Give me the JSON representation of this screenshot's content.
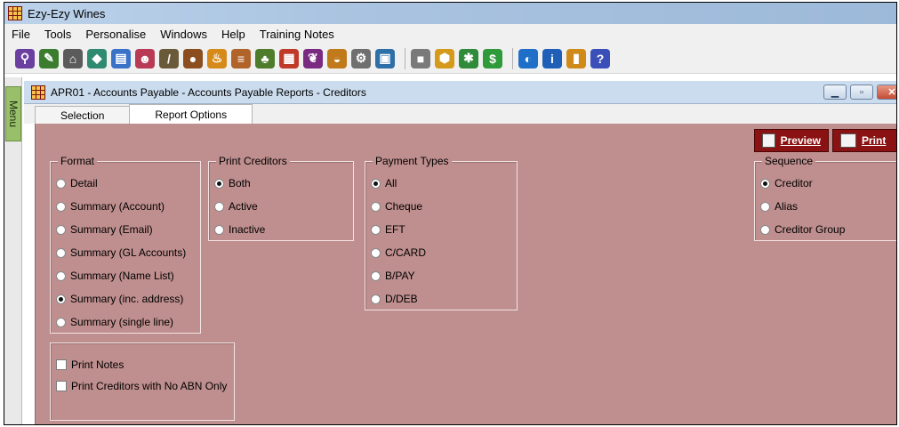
{
  "app": {
    "title": "Ezy-Ezy Wines"
  },
  "menubar": [
    "File",
    "Tools",
    "Personalise",
    "Windows",
    "Help",
    "Training Notes"
  ],
  "toolbar": {
    "icons": [
      {
        "name": "wine-glass-icon",
        "color": "#6a3fa0",
        "glyph": "⚲"
      },
      {
        "name": "pen-icon",
        "color": "#3b7c2f",
        "glyph": "✎"
      },
      {
        "name": "bank-icon",
        "color": "#5b5b5b",
        "glyph": "⌂"
      },
      {
        "name": "label-icon",
        "color": "#2f8a6f",
        "glyph": "◆"
      },
      {
        "name": "document-icon",
        "color": "#3a72c8",
        "glyph": "▤"
      },
      {
        "name": "people-icon",
        "color": "#b83a55",
        "glyph": "☻"
      },
      {
        "name": "stick-icon",
        "color": "#6a5a3a",
        "glyph": "/"
      },
      {
        "name": "barrel-icon",
        "color": "#8c4e1f",
        "glyph": "●"
      },
      {
        "name": "bottle-icon",
        "color": "#d68a1a",
        "glyph": "♨"
      },
      {
        "name": "cellar-icon",
        "color": "#b0642a",
        "glyph": "≡"
      },
      {
        "name": "vineyard-icon",
        "color": "#4d7c2a",
        "glyph": "♣"
      },
      {
        "name": "crates-icon",
        "color": "#c03a2a",
        "glyph": "▦"
      },
      {
        "name": "grapes-icon",
        "color": "#7a2a80",
        "glyph": "❦"
      },
      {
        "name": "basket-icon",
        "color": "#c07a1a",
        "glyph": "◒"
      },
      {
        "name": "settings-icon",
        "color": "#6f6f6f",
        "glyph": "⚙"
      },
      {
        "name": "report-icon",
        "color": "#2e6fa8",
        "glyph": "▣"
      },
      {
        "name": "sep",
        "color": "",
        "glyph": ""
      },
      {
        "name": "printer-icon",
        "color": "#7a7a7a",
        "glyph": "■"
      },
      {
        "name": "box-icon",
        "color": "#d59a1b",
        "glyph": "⬢"
      },
      {
        "name": "gear-green-icon",
        "color": "#2f8a3a",
        "glyph": "✱"
      },
      {
        "name": "dollar-icon",
        "color": "#2f9a3a",
        "glyph": "$"
      },
      {
        "name": "sep",
        "color": "",
        "glyph": ""
      },
      {
        "name": "globe-icon",
        "color": "#1f6fc8",
        "glyph": "◐"
      },
      {
        "name": "info-icon",
        "color": "#1f5fb8",
        "glyph": "i"
      },
      {
        "name": "bookmark-icon",
        "color": "#d08a1a",
        "glyph": "▮"
      },
      {
        "name": "help-icon",
        "color": "#3a4fb8",
        "glyph": "?"
      }
    ]
  },
  "sidebar": {
    "menu_label": "Menu"
  },
  "window": {
    "title": "APR01 - Accounts Payable - Accounts Payable Reports -  Creditors",
    "minimize": "▁",
    "maximize": "▫",
    "close": "✕"
  },
  "tabs": [
    {
      "label": "Selection",
      "active": false
    },
    {
      "label": "Report Options",
      "active": true
    }
  ],
  "actions": {
    "preview": "Preview",
    "print": "Print"
  },
  "format": {
    "legend": "Format",
    "options": [
      {
        "label": "Detail",
        "checked": false
      },
      {
        "label": "Summary (Account)",
        "checked": false
      },
      {
        "label": "Summary (Email)",
        "checked": false
      },
      {
        "label": "Summary (GL Accounts)",
        "checked": false
      },
      {
        "label": "Summary (Name List)",
        "checked": false
      },
      {
        "label": "Summary (inc. address)",
        "checked": true
      },
      {
        "label": "Summary (single line)",
        "checked": false
      }
    ]
  },
  "print_creditors": {
    "legend": "Print Creditors",
    "options": [
      {
        "label": "Both",
        "checked": true
      },
      {
        "label": "Active",
        "checked": false
      },
      {
        "label": "Inactive",
        "checked": false
      }
    ]
  },
  "payment_types": {
    "legend": "Payment Types",
    "options": [
      {
        "label": "All",
        "checked": true
      },
      {
        "label": "Cheque",
        "checked": false
      },
      {
        "label": "EFT",
        "checked": false
      },
      {
        "label": "C/CARD",
        "checked": false
      },
      {
        "label": "B/PAY",
        "checked": false
      },
      {
        "label": "D/DEB",
        "checked": false
      }
    ]
  },
  "sequence": {
    "legend": "Sequence",
    "options": [
      {
        "label": "Creditor",
        "checked": true
      },
      {
        "label": "Alias",
        "checked": false
      },
      {
        "label": "Creditor Group",
        "checked": false
      }
    ]
  },
  "checkboxes": [
    {
      "label": "Print Notes",
      "checked": false
    },
    {
      "label": "Print Creditors with No ABN Only",
      "checked": false
    }
  ]
}
